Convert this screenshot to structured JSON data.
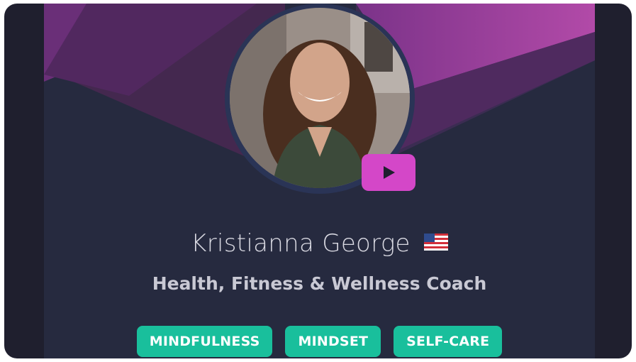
{
  "profile": {
    "name": "Kristianna George",
    "country_flag": "us-flag-icon",
    "role": "Health, Fitness & Wellness Coach",
    "tags": [
      "MINDFULNESS",
      "MINDSET",
      "SELF-CARE"
    ]
  },
  "colors": {
    "frame": "#1f1f2e",
    "card": "#262a3f",
    "banner_purple": "#7a2f86",
    "play_button": "#d447c8",
    "tag_bg": "#19bf9c"
  }
}
